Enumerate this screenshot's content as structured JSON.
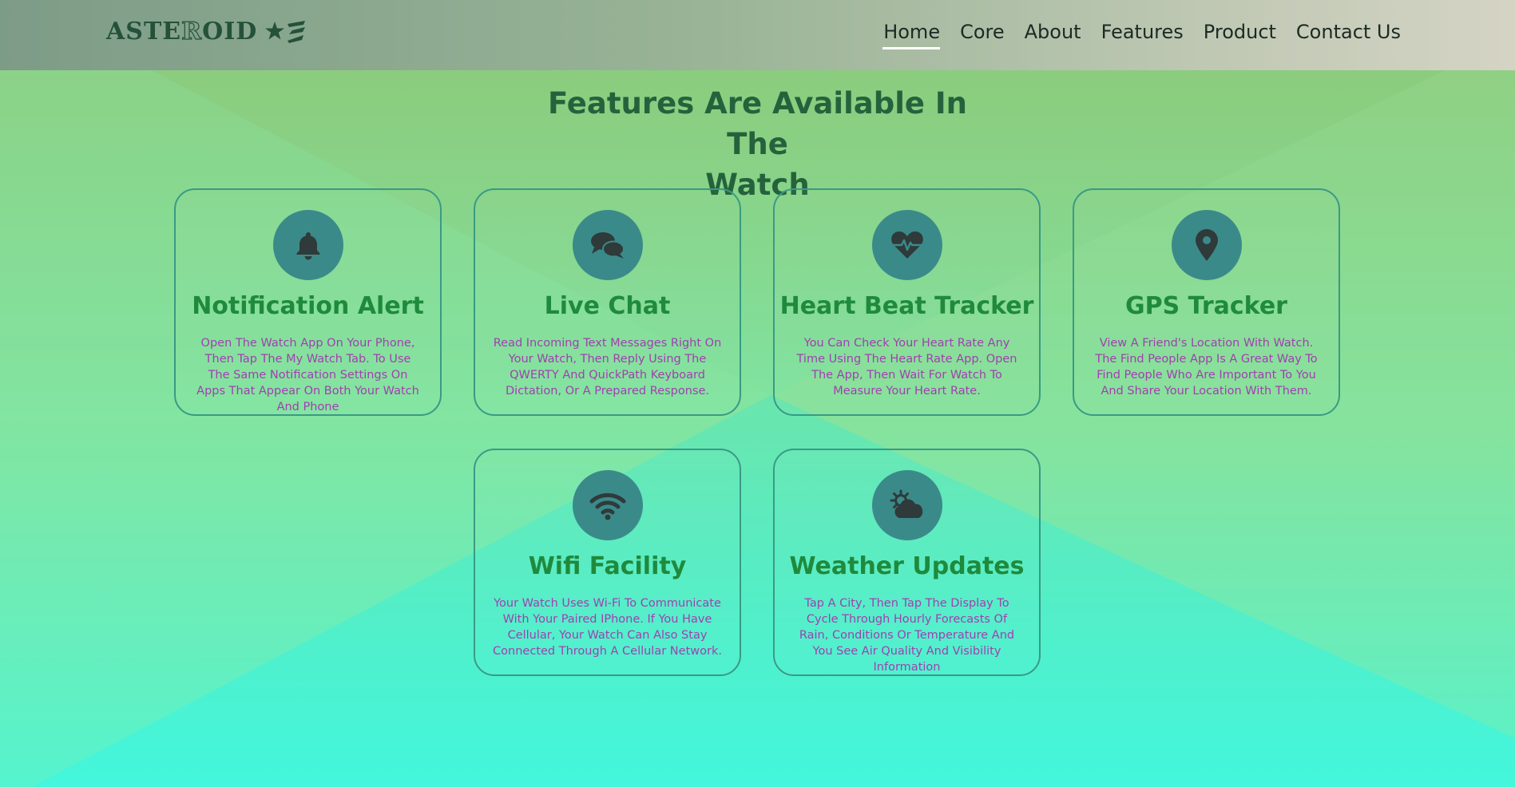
{
  "header": {
    "logo": {
      "text_a": "ASTE",
      "text_b": "R",
      "text_c": "OID",
      "mark_icon": "star-stripes-icon"
    },
    "nav": [
      {
        "label": "Home",
        "active": true
      },
      {
        "label": "Core",
        "active": false
      },
      {
        "label": "About",
        "active": false
      },
      {
        "label": "Features",
        "active": false
      },
      {
        "label": "Product",
        "active": false
      },
      {
        "label": "Contact Us",
        "active": false
      }
    ]
  },
  "section": {
    "title_line1": "Features Are Available In The",
    "title_line2": "Watch"
  },
  "features": [
    {
      "icon": "bell-icon",
      "title": "Notification Alert",
      "description": "Open The Watch App On Your Phone, Then Tap The My Watch Tab. To Use The Same Notification Settings On Apps That Appear On Both Your Watch And Phone"
    },
    {
      "icon": "chat-bubbles-icon",
      "title": "Live Chat",
      "description": "Read Incoming Text Messages Right On Your Watch, Then Reply Using The QWERTY And QuickPath Keyboard Dictation, Or A Prepared Response."
    },
    {
      "icon": "heart-pulse-icon",
      "title": "Heart Beat Tracker",
      "description": "You Can Check Your Heart Rate Any Time Using The Heart Rate App. Open The App, Then Wait For Watch To Measure Your Heart Rate."
    },
    {
      "icon": "map-pin-icon",
      "title": "GPS Tracker",
      "description": "View A Friend's Location With Watch. The Find People App Is A Great Way To Find People Who Are Important To You And Share Your Location With Them."
    },
    {
      "icon": "wifi-icon",
      "title": "Wifi Facility",
      "description": "Your Watch Uses Wi-Fi To Communicate With Your Paired IPhone. If You Have Cellular, Your Watch Can Also Stay Connected Through A Cellular Network."
    },
    {
      "icon": "sun-cloud-icon",
      "title": "Weather Updates",
      "description": "Tap A City, Then Tap The Display To Cycle Through Hourly Forecasts Of Rain, Conditions Or Temperature And You See Air Quality And Visibility Information"
    }
  ],
  "colors": {
    "heading": "#25623c",
    "card_title": "#1f8a3c",
    "card_desc": "#a13fb0",
    "icon_circle": "#3b8a8a",
    "icon_glyph": "#2f3a3a",
    "card_border": "#3a9a84"
  }
}
